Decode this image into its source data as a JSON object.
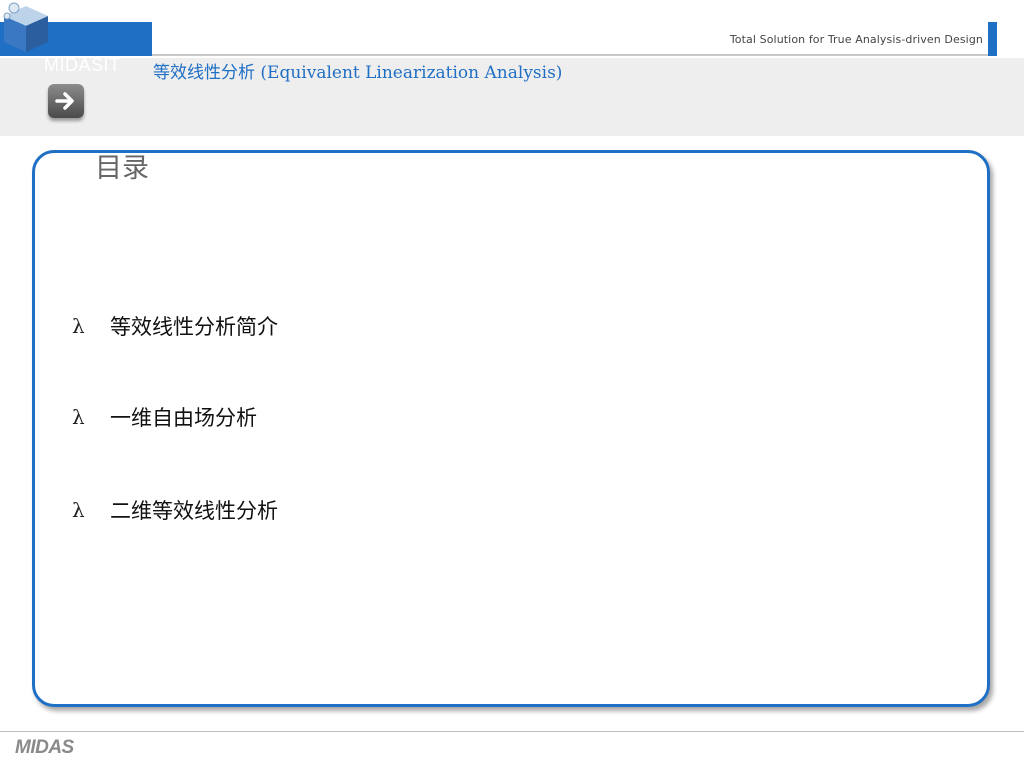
{
  "header": {
    "tagline": "Total Solution for True Analysis-driven Design",
    "brand": "MIDASIT",
    "title": "等效线性分析  (Equivalent Linearization  Analysis)"
  },
  "toc": {
    "heading": "目录",
    "bullet": "λ",
    "items": [
      {
        "label": "等效线性分析简介"
      },
      {
        "label": "一维自由场分析"
      },
      {
        "label": "二维等效线性分析"
      }
    ]
  },
  "footer": {
    "logo": "MIDAS"
  },
  "colors": {
    "accent": "#1f6fc5",
    "band": "#eeeeee"
  },
  "icons": [
    "cube-logo-icon",
    "arrow-right-icon"
  ]
}
